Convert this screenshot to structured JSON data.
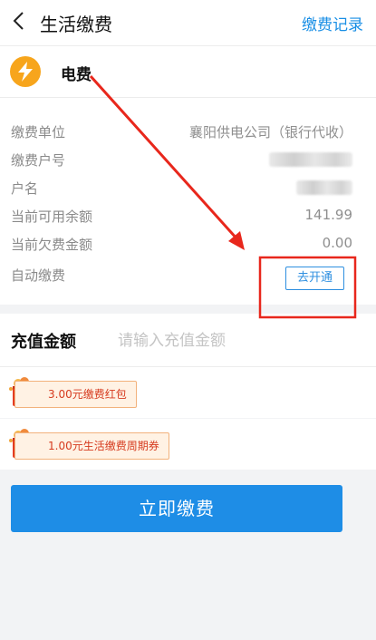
{
  "header": {
    "title": "生活缴费",
    "right_link": "缴费记录"
  },
  "biller": {
    "name": "电费",
    "icon": "lightning-bolt-icon"
  },
  "info_rows": [
    {
      "label": "缴费单位",
      "value": "襄阳供电公司（银行代收）"
    },
    {
      "label": "缴费户号",
      "value": ""
    },
    {
      "label": "户名",
      "value": ""
    },
    {
      "label": "当前可用余额",
      "value": "141.99"
    },
    {
      "label": "当前欠费金额",
      "value": "0.00"
    },
    {
      "label": "自动缴费",
      "button": "去开通"
    }
  ],
  "recharge": {
    "label": "充值金额",
    "placeholder": "请输入充值金额",
    "value": ""
  },
  "coupons": [
    {
      "text": "3.00元缴费红包"
    },
    {
      "text": "1.00元生活缴费周期券"
    }
  ],
  "pay_button": "立即缴费",
  "colors": {
    "accent": "#1e8de6",
    "annotation": "#e8271c",
    "bolt": "#f7a51c"
  }
}
